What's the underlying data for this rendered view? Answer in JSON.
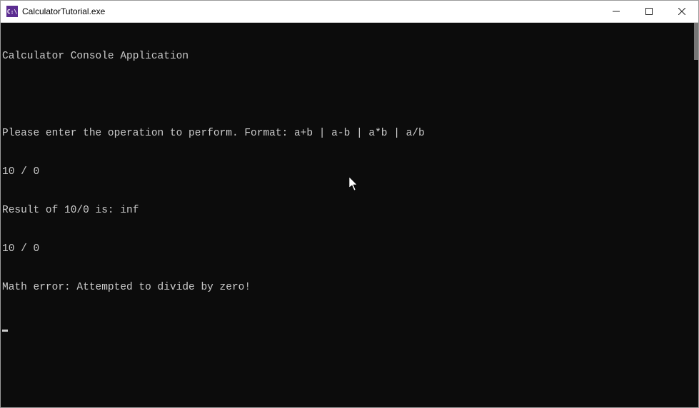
{
  "window": {
    "title": "CalculatorTutorial.exe",
    "icon_label": "C:\\"
  },
  "console": {
    "lines": [
      "Calculator Console Application",
      "",
      "Please enter the operation to perform. Format: a+b | a-b | a*b | a/b",
      "10 / 0",
      "Result of 10/0 is: inf",
      "10 / 0",
      "Math error: Attempted to divide by zero!"
    ]
  }
}
